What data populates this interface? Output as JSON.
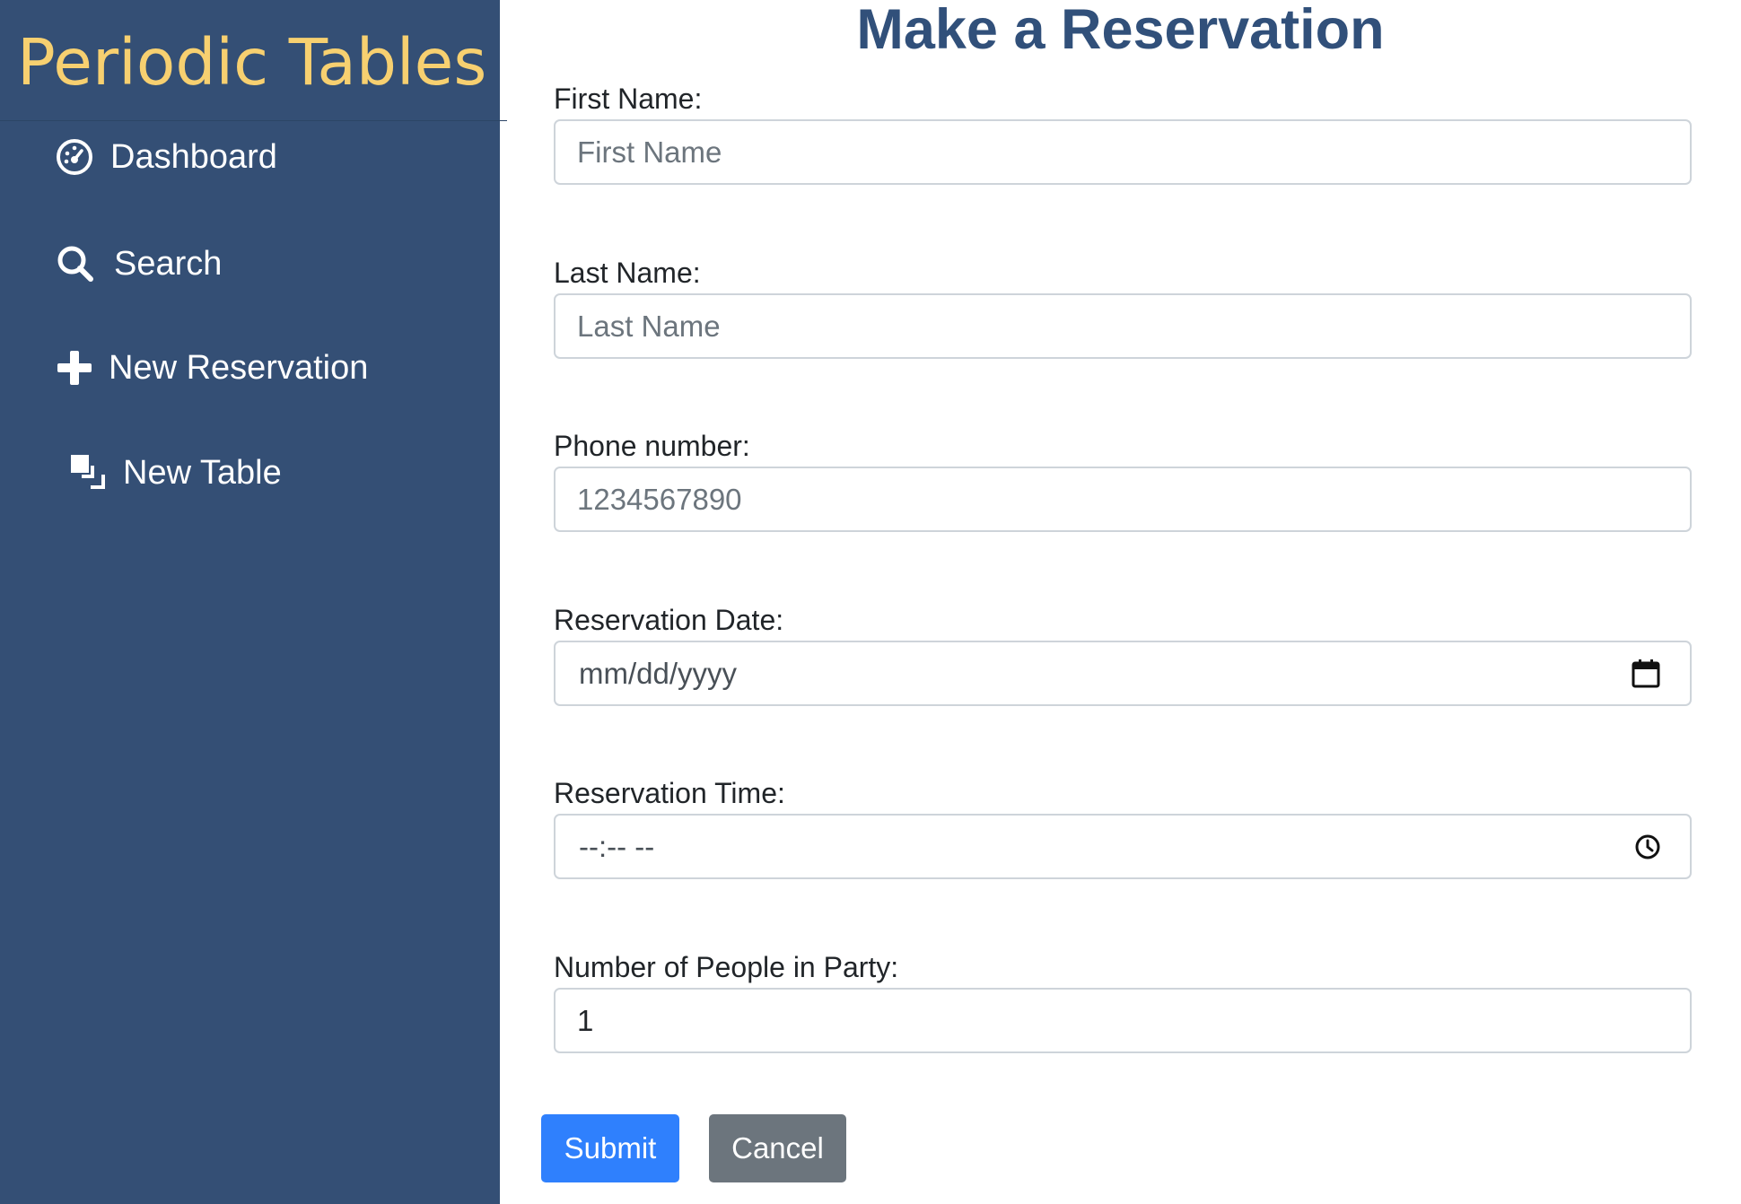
{
  "sidebar": {
    "brand": "Periodic Tables",
    "items": [
      {
        "label": "Dashboard",
        "icon": "dashboard-icon"
      },
      {
        "label": "Search",
        "icon": "search-icon"
      },
      {
        "label": "New Reservation",
        "icon": "plus-icon"
      },
      {
        "label": "New Table",
        "icon": "new-table-icon"
      }
    ]
  },
  "main": {
    "title": "Make a Reservation",
    "fields": {
      "first_name": {
        "label": "First Name:",
        "placeholder": "First Name",
        "value": ""
      },
      "last_name": {
        "label": "Last Name:",
        "placeholder": "Last Name",
        "value": ""
      },
      "phone": {
        "label": "Phone number:",
        "placeholder": "1234567890",
        "value": ""
      },
      "date": {
        "label": "Reservation Date:",
        "display": "mm/dd/yyyy",
        "icon": "calendar-icon"
      },
      "time": {
        "label": "Reservation Time:",
        "display": "--:-- --",
        "icon": "clock-icon"
      },
      "people": {
        "label": "Number of People in Party:",
        "value": "1"
      }
    },
    "buttons": {
      "submit": "Submit",
      "cancel": "Cancel"
    }
  },
  "colors": {
    "sidebar_bg": "#344f75",
    "brand": "#f7d070",
    "title": "#31507a",
    "primary": "#2f80fd",
    "secondary": "#6c757d"
  }
}
